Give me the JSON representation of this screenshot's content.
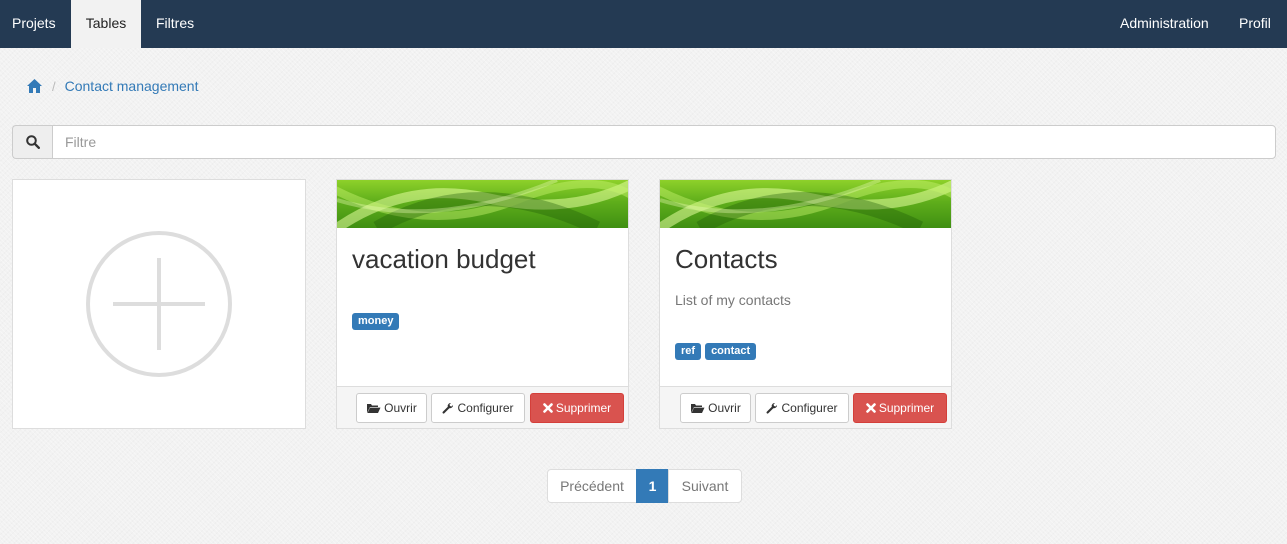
{
  "navbar": {
    "left": [
      {
        "label": "Projets"
      },
      {
        "label": "Tables",
        "active": true
      },
      {
        "label": "Filtres"
      }
    ],
    "right": [
      {
        "label": "Administration"
      },
      {
        "label": "Profil"
      }
    ],
    "bg_color": "#243a53"
  },
  "breadcrumb": {
    "home_icon": "home-icon",
    "items": [
      "Contact management"
    ]
  },
  "search": {
    "icon": "search-icon",
    "placeholder": "Filtre",
    "value": ""
  },
  "add_card": {
    "icon": "plus-circle-icon"
  },
  "cards": [
    {
      "title": "vacation budget",
      "description": "",
      "tags": [
        "money"
      ],
      "buttons": {
        "open": "Ouvrir",
        "configure": "Configurer",
        "delete": "Supprimer"
      }
    },
    {
      "title": "Contacts",
      "description": "List of my contacts",
      "tags": [
        "ref",
        "contact"
      ],
      "buttons": {
        "open": "Ouvrir",
        "configure": "Configurer",
        "delete": "Supprimer"
      }
    }
  ],
  "pagination": {
    "prev": "Précédent",
    "current": "1",
    "next": "Suivant"
  },
  "colors": {
    "accent": "#337ab7",
    "danger": "#d9534f",
    "banner_green": "#6cbf1f"
  }
}
